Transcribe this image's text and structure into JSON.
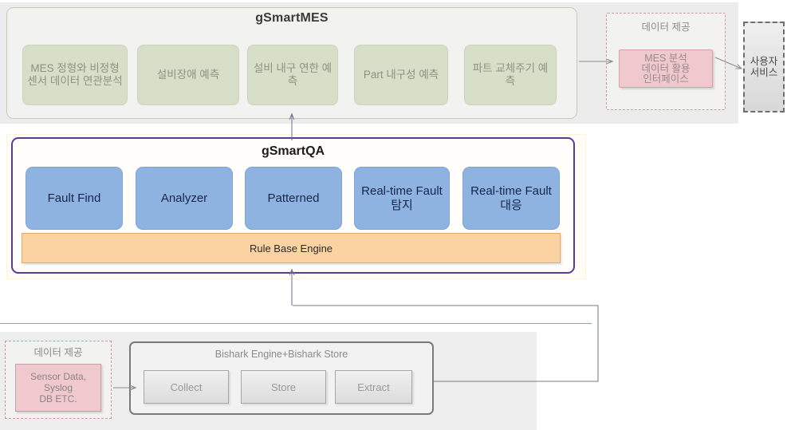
{
  "mes": {
    "title": "gSmartMES",
    "boxes": [
      "MES 정형와 비정형 센서 데이터 연관분석",
      "설비장애 예측",
      "설비 내구 연한 예측",
      "Part 내구성 예측",
      "파트 교체주기 예측"
    ]
  },
  "provision_top": {
    "label": "데이터 제공",
    "interface_line1": "MES 분석",
    "interface_line2": "데이터 활용",
    "interface_line3": "인터페이스"
  },
  "user_service": {
    "line1": "사용자",
    "line2": "서비스"
  },
  "qa": {
    "title": "gSmartQA",
    "boxes": [
      "Fault Find",
      "Analyzer",
      "Patterned",
      "Real-time Fault 탐지",
      "Real-time Fault 대응"
    ],
    "rule_engine": "Rule Base Engine"
  },
  "provision_bottom": {
    "label": "데이터 제공",
    "source_line1": "Sensor Data,",
    "source_line2": "Syslog",
    "source_line3": "DB ETC."
  },
  "bishark": {
    "title": "Bishark Engine+Bishark Store",
    "boxes": [
      "Collect",
      "Store",
      "Extract"
    ]
  },
  "colors": {
    "mes_box": "#d7dfc8",
    "qa_box": "#8fb3e0",
    "rule_engine": "#fbd2a2",
    "qa_border": "#5b3a96",
    "pink_box": "#f0c9ce",
    "dashed_pink": "#d09aa6",
    "blue_divider": "#7ba7c4"
  }
}
